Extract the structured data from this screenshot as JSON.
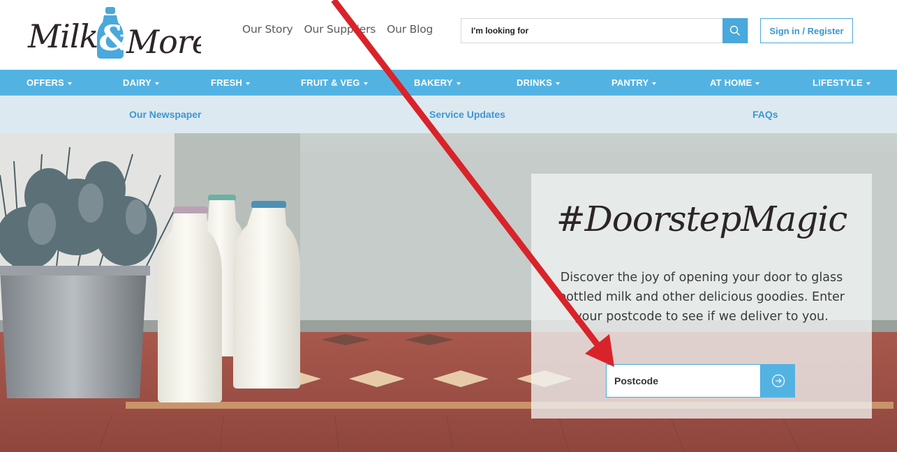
{
  "brand": {
    "name": "Milk & More",
    "accent": "#52b3e3",
    "link_blue": "#3d97cf"
  },
  "header": {
    "links": [
      "Our Story",
      "Our Suppliers",
      "Our Blog"
    ],
    "search": {
      "placeholder": "I'm looking for",
      "icon": "search-icon"
    },
    "signin_label": "Sign in / Register"
  },
  "main_nav": {
    "items": [
      {
        "label": "OFFERS"
      },
      {
        "label": "DAIRY"
      },
      {
        "label": "FRESH"
      },
      {
        "label": "FRUIT & VEG"
      },
      {
        "label": "BAKERY"
      },
      {
        "label": "DRINKS"
      },
      {
        "label": "PANTRY"
      },
      {
        "label": "AT HOME"
      },
      {
        "label": "LIFESTYLE"
      }
    ]
  },
  "sub_nav": {
    "items": [
      "Our Newspaper",
      "Service Updates",
      "FAQs"
    ]
  },
  "hero": {
    "title": "#DoorstepMagic",
    "text": "Discover the joy of opening your door to glass bottled milk and other delicious goodies. Enter your postcode to see if we deliver to you.",
    "postcode_placeholder": "Postcode",
    "submit_icon": "arrow-right-circle-icon"
  },
  "annotation": {
    "type": "red-arrow",
    "color": "#d9232a",
    "points_to": "postcode-input"
  }
}
